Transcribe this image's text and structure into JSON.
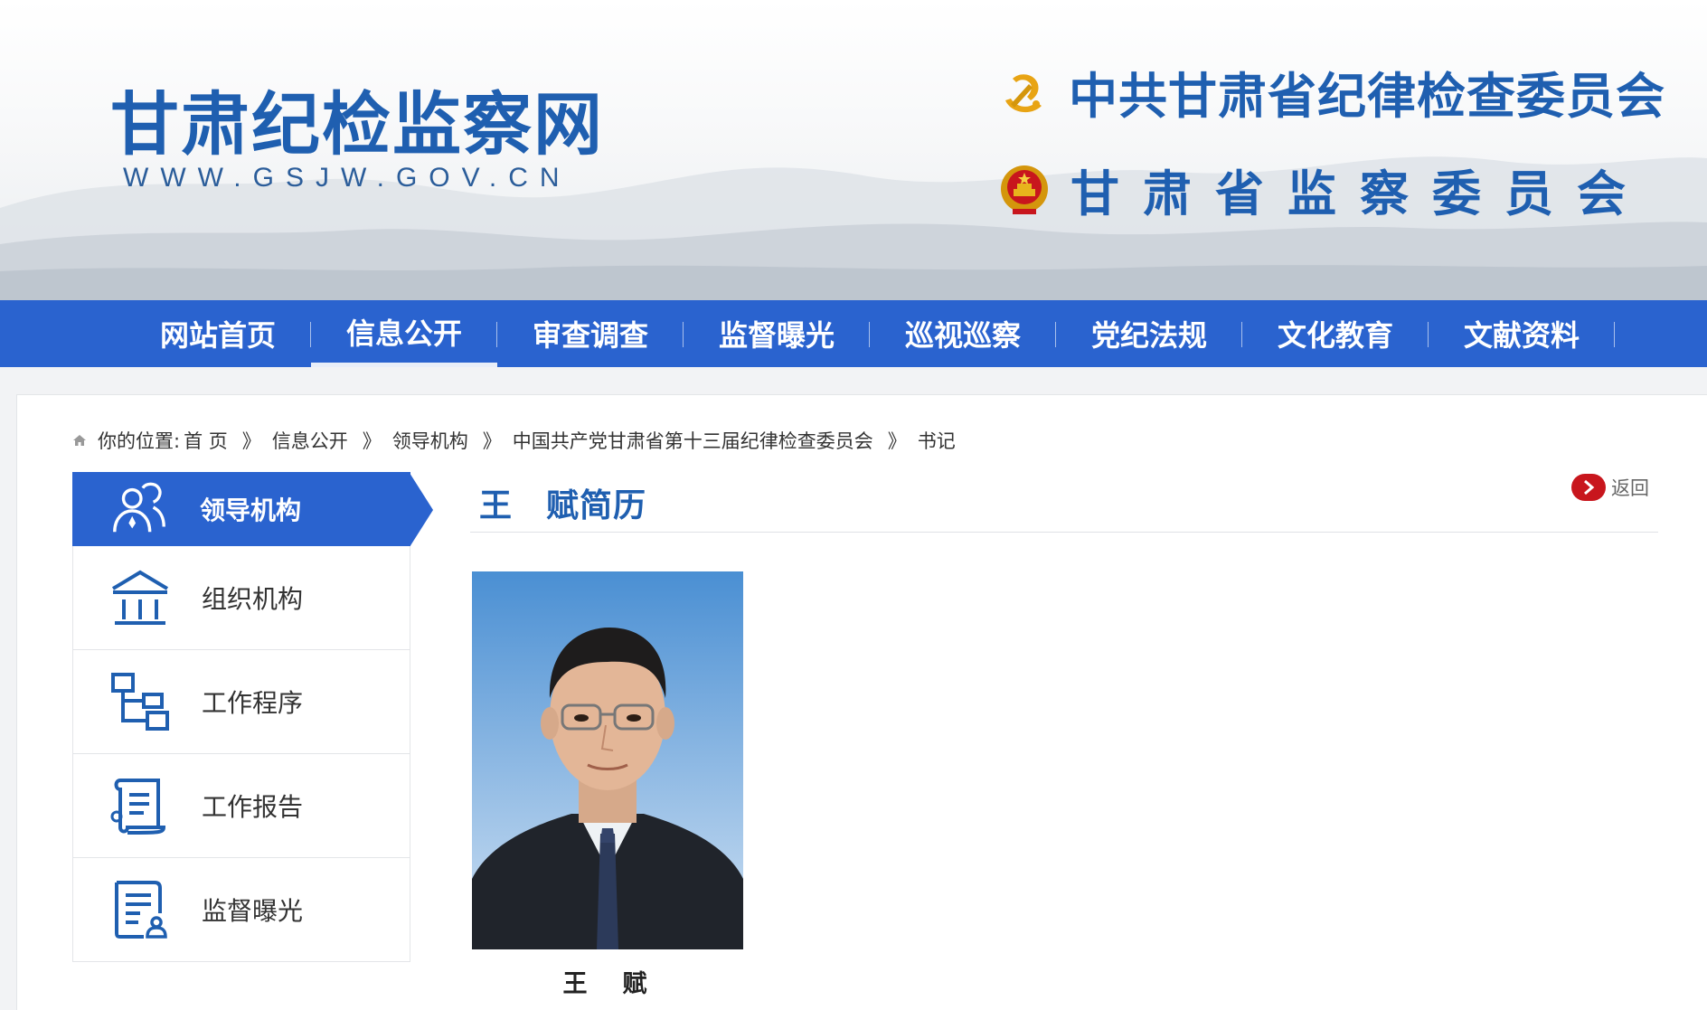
{
  "header": {
    "site_title": "甘肃纪检监察网",
    "site_url": "WWW.GSJW.GOV.CN",
    "org_primary": "中共甘肃省纪律检查委员会",
    "org_secondary": "甘肃省监察委员会",
    "emblem_primary": "party-emblem-icon",
    "emblem_secondary": "national-emblem-icon"
  },
  "nav": {
    "items": [
      {
        "label": "网站首页"
      },
      {
        "label": "信息公开"
      },
      {
        "label": "审查调查"
      },
      {
        "label": "监督曝光"
      },
      {
        "label": "巡视巡察"
      },
      {
        "label": "党纪法规"
      },
      {
        "label": "文化教育"
      },
      {
        "label": "文献资料"
      }
    ],
    "active_index": 1,
    "color": "#2a63cf"
  },
  "breadcrumb": {
    "prefix": "你的位置:",
    "items": [
      "首 页",
      "信息公开",
      "领导机构",
      "中国共产党甘肃省第十三届纪律检查委员会",
      "书记"
    ],
    "separator": "》"
  },
  "sidebar": {
    "items": [
      {
        "label": "领导机构",
        "icon": "people-icon"
      },
      {
        "label": "组织机构",
        "icon": "building-icon"
      },
      {
        "label": "工作程序",
        "icon": "flowchart-icon"
      },
      {
        "label": "工作报告",
        "icon": "scroll-report-icon"
      },
      {
        "label": "监督曝光",
        "icon": "document-person-icon"
      }
    ],
    "active_index": 0
  },
  "article": {
    "title": "王　赋简历",
    "back_label": "返回",
    "photo_caption": "王　赋"
  },
  "colors": {
    "brand_blue": "#2a63cf",
    "title_blue": "#1f5fb0",
    "back_red": "#c8161d"
  }
}
